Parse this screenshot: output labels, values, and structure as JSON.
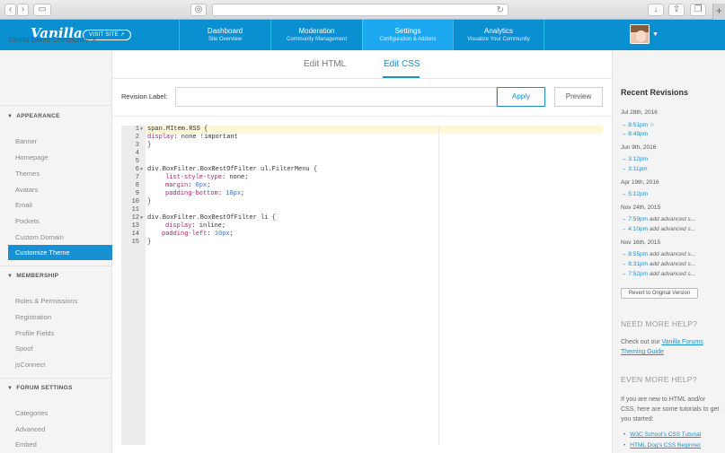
{
  "browser": {
    "reload_icon": "reload-icon",
    "plus": "+"
  },
  "topnav": {
    "logo": "Vanilla",
    "visit_site": "VISIT SITE ↗",
    "tabs": [
      {
        "title": "Dashboard",
        "sub": "Site Overview"
      },
      {
        "title": "Moderation",
        "sub": "Community Management"
      },
      {
        "title": "Settings",
        "sub": "Configuration & Addons"
      },
      {
        "title": "Analytics",
        "sub": "Visualize Your Community"
      }
    ]
  },
  "sidebar": {
    "community": "Vanilla Demo Community ↗",
    "sections": [
      {
        "title": "APPEARANCE",
        "items": [
          "Banner",
          "Homepage",
          "Themes",
          "Avatars",
          "Email",
          "Pockets",
          "Custom Domain",
          "Customize Theme"
        ]
      },
      {
        "title": "MEMBERSHIP",
        "items": [
          "Roles & Permissions",
          "Registration",
          "Profile Fields",
          "Spoof",
          "jsConnect"
        ]
      },
      {
        "title": "FORUM SETTINGS",
        "items": [
          "Categories",
          "Advanced",
          "Embed"
        ]
      }
    ],
    "active_item": "Customize Theme"
  },
  "editor_tabs": {
    "html": "Edit HTML",
    "css": "Edit CSS"
  },
  "revision": {
    "label": "Revision Label:",
    "value": "",
    "apply": "Apply",
    "preview": "Preview"
  },
  "code_lines": [
    "1",
    "2",
    "3",
    "4",
    "5",
    "6",
    "7",
    "8",
    "9",
    "10",
    "11",
    "12",
    "13",
    "14",
    "15"
  ],
  "code": {
    "l1": "span.MItem.RSS {",
    "l2a": "display",
    "l2b": ": none !important",
    "l3": "}",
    "l6": "div.BoxFilter.BoxBestOfFilter ul.FilterMenu {",
    "l7a": "list-style-type",
    "l7b": ": none;",
    "l8a": "margin",
    "l8b": ": ",
    "l8c": "0px",
    "l8d": ";",
    "l9a": "padding-bottom",
    "l9b": ": ",
    "l9c": "10px",
    "l9d": ";",
    "l10": "}",
    "l12": "div.BoxFilter.BoxBestOfFilter li {",
    "l13a": "display",
    "l13b": ": inline;",
    "l14a": "padding-left",
    "l14b": ": ",
    "l14c": "10px",
    "l14d": ";",
    "l15": "}"
  },
  "recent": {
    "title": "Recent Revisions",
    "groups": [
      {
        "date": "Jul 28th, 2016",
        "links": [
          {
            "time": "→ 8:51pm ☆",
            "note": ""
          },
          {
            "time": "→ 8:49pm",
            "note": ""
          }
        ]
      },
      {
        "date": "Jun 9th, 2016",
        "links": [
          {
            "time": "→ 3:12pm",
            "note": ""
          },
          {
            "time": "→ 3:11pm",
            "note": ""
          }
        ]
      },
      {
        "date": "Apr 19th, 2016",
        "links": [
          {
            "time": "→ 5:12pm",
            "note": ""
          }
        ]
      },
      {
        "date": "Nov 24th, 2015",
        "links": [
          {
            "time": "→ 7:59pm",
            "note": "add advanced s..."
          },
          {
            "time": "→ 4:10pm",
            "note": "add advanced s..."
          }
        ]
      },
      {
        "date": "Nov 16th, 2015",
        "links": [
          {
            "time": "→ 8:55pm",
            "note": "add advanced s..."
          },
          {
            "time": "→ 8:31pm",
            "note": "add advanced s..."
          },
          {
            "time": "→ 7:52pm",
            "note": "add advanced s..."
          }
        ]
      }
    ],
    "revert": "Revert to Original Version"
  },
  "help": {
    "need_title": "NEED MORE HELP?",
    "need_text": "Check out our ",
    "need_link": "Vanilla Forums Theming Guide",
    "even_title": "EVEN MORE HELP?",
    "even_text": "If you are new to HTML and/or CSS, here are some tutorials to get you started:",
    "tutorials": [
      "W3C School's CSS Tutorial",
      "HTML Dog's CSS Beginner"
    ]
  }
}
